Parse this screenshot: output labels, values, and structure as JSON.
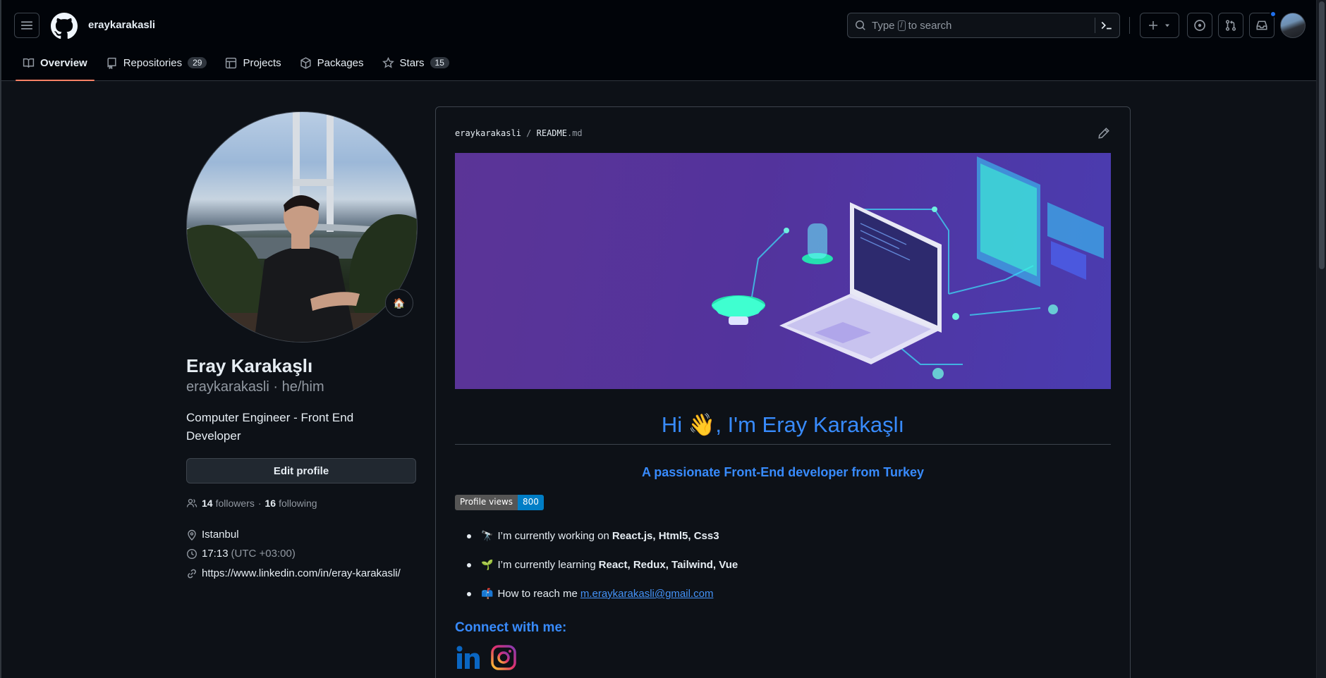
{
  "header": {
    "username": "eraykarakasli",
    "search_prefix": "Type",
    "search_key": "/",
    "search_suffix": "to search"
  },
  "tabs": [
    {
      "label": "Overview",
      "icon": "book-icon"
    },
    {
      "label": "Repositories",
      "count": "29",
      "icon": "repo-icon"
    },
    {
      "label": "Projects",
      "icon": "table-icon"
    },
    {
      "label": "Packages",
      "icon": "package-icon"
    },
    {
      "label": "Stars",
      "count": "15",
      "icon": "star-icon"
    }
  ],
  "profile": {
    "name": "Eray Karakaşlı",
    "handle": "eraykarakasli · he/him",
    "bio": "Computer Engineer - Front End Developer",
    "edit_label": "Edit profile",
    "status_emoji": "🏠",
    "followers_count": "14",
    "followers_label": "followers",
    "following_count": "16",
    "following_label": "following",
    "dot": "·",
    "location": "Istanbul",
    "time": "17:13",
    "timezone": "(UTC +03:00)",
    "link": "https://www.linkedin.com/in/eray-karakasli/"
  },
  "readme": {
    "path_user": "eraykarakasli",
    "path_sep": "/",
    "path_file": "README",
    "path_ext": ".md",
    "greeting": "Hi 👋, I'm Eray Karakaşlı",
    "subtitle": "A passionate Front-End developer from Turkey",
    "badge_label": "Profile views",
    "badge_value": "800",
    "bullets": [
      {
        "emoji": "🔭",
        "text": "I’m currently working on",
        "bold": "React.js, Html5, Css3"
      },
      {
        "emoji": "🌱",
        "text": "I’m currently learning",
        "bold": "React, Redux, Tailwind, Vue"
      },
      {
        "emoji": "📫",
        "text": "How to reach me",
        "link": "m.eraykarakasli@gmail.com"
      }
    ],
    "connect": "Connect with me:"
  },
  "colors": {
    "accent_blue": "#388bfd",
    "tab_underline": "#f78166",
    "background": "#0d1117"
  }
}
